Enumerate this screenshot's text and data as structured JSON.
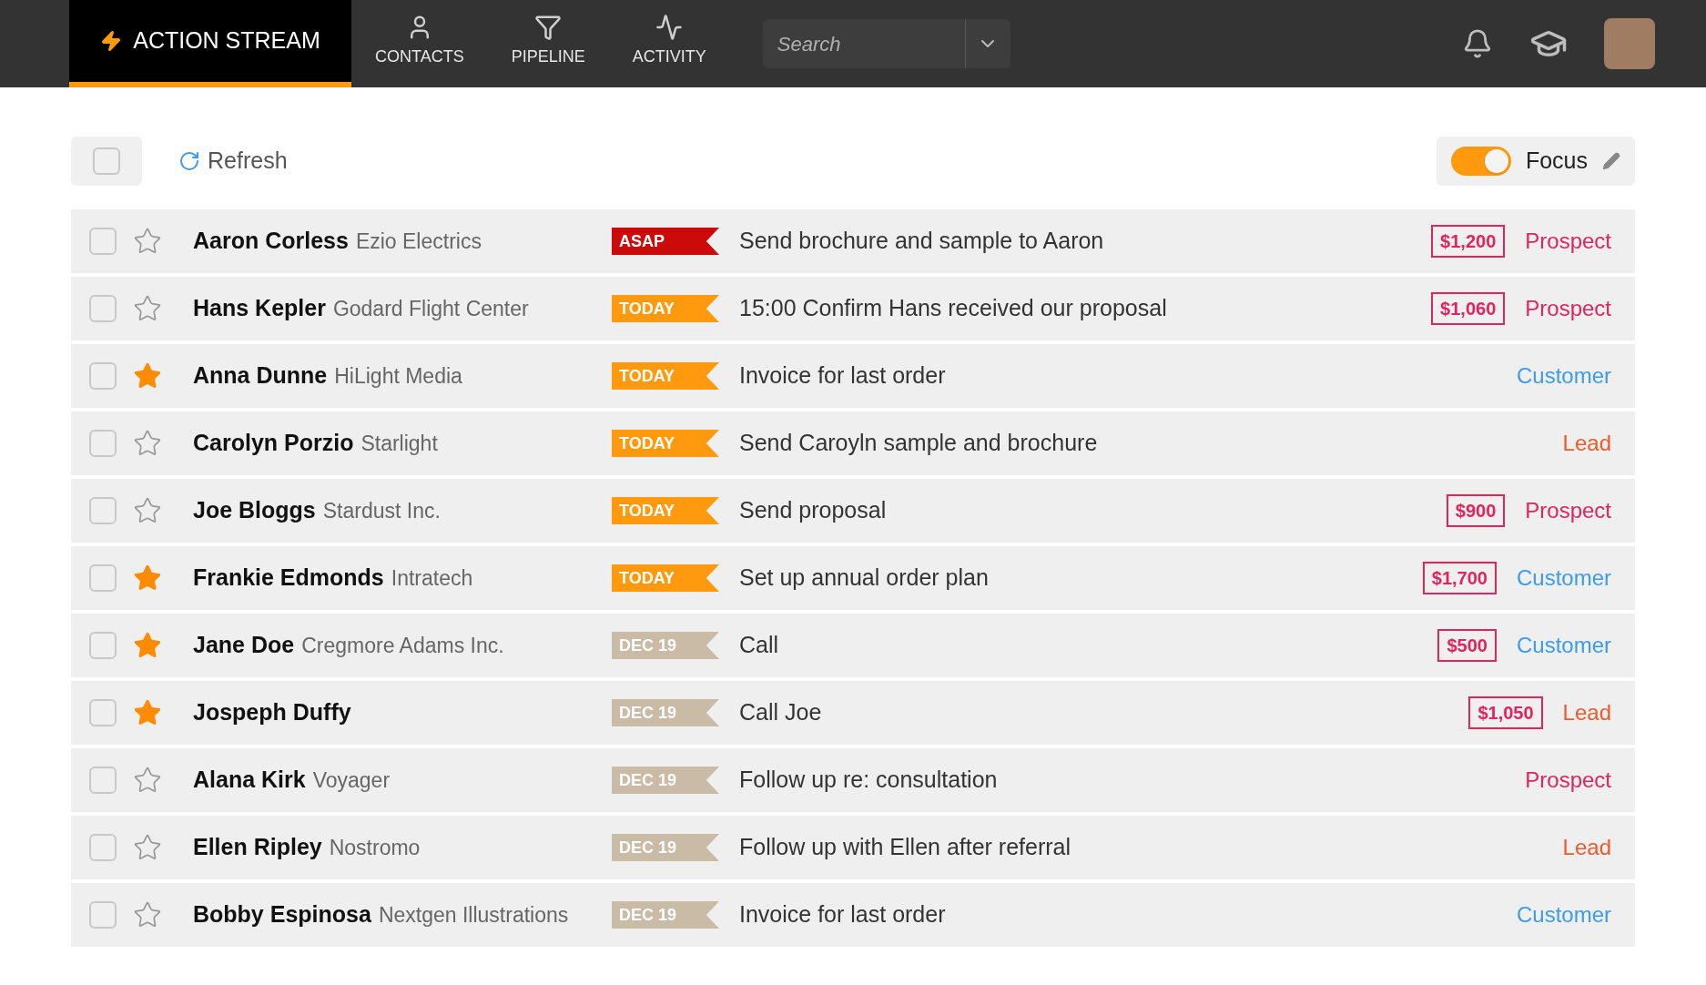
{
  "nav": {
    "tabs": [
      {
        "label": "ACTION STREAM",
        "selected": true
      },
      {
        "label": "CONTACTS",
        "selected": false
      },
      {
        "label": "PIPELINE",
        "selected": false
      },
      {
        "label": "ACTIVITY",
        "selected": false
      }
    ],
    "search": {
      "placeholder": "Search"
    }
  },
  "toolbar": {
    "select_all": {
      "checked": false
    },
    "refresh": "Refresh",
    "focus": {
      "label": "Focus",
      "on": true
    }
  },
  "rows": [
    {
      "checked": false,
      "starred": false,
      "name": "Aaron Corless",
      "company": "Ezio Electrics",
      "tag": {
        "kind": "asap",
        "label": "ASAP"
      },
      "task": "Send brochure and sample to Aaron",
      "amount": "$1,200",
      "status": {
        "kind": "prospect",
        "label": "Prospect"
      }
    },
    {
      "checked": false,
      "starred": false,
      "name": "Hans Kepler",
      "company": "Godard Flight Center",
      "tag": {
        "kind": "today",
        "label": "TODAY"
      },
      "task": "15:00 Confirm Hans received our proposal",
      "amount": "$1,060",
      "status": {
        "kind": "prospect",
        "label": "Prospect"
      }
    },
    {
      "checked": false,
      "starred": true,
      "name": "Anna Dunne",
      "company": "HiLight Media",
      "tag": {
        "kind": "today",
        "label": "TODAY"
      },
      "task": "Invoice for last order",
      "status": {
        "kind": "customer",
        "label": "Customer"
      }
    },
    {
      "checked": false,
      "starred": false,
      "name": "Carolyn Porzio",
      "company": "Starlight",
      "tag": {
        "kind": "today",
        "label": "TODAY"
      },
      "task": "Send Caroyln sample and brochure",
      "status": {
        "kind": "lead",
        "label": "Lead"
      }
    },
    {
      "checked": false,
      "starred": false,
      "name": "Joe Bloggs",
      "company": "Stardust Inc.",
      "tag": {
        "kind": "today",
        "label": "TODAY"
      },
      "task": "Send proposal",
      "amount": "$900",
      "status": {
        "kind": "prospect",
        "label": "Prospect"
      }
    },
    {
      "checked": false,
      "starred": true,
      "name": "Frankie Edmonds",
      "company": "Intratech",
      "tag": {
        "kind": "today",
        "label": "TODAY"
      },
      "task": "Set up annual order plan",
      "amount": "$1,700",
      "status": {
        "kind": "customer",
        "label": "Customer"
      }
    },
    {
      "checked": false,
      "starred": true,
      "name": "Jane Doe",
      "company": "Cregmore Adams Inc.",
      "tag": {
        "kind": "date",
        "label": "DEC 19"
      },
      "task": "Call",
      "amount": "$500",
      "status": {
        "kind": "customer",
        "label": "Customer"
      }
    },
    {
      "checked": false,
      "starred": true,
      "name": "Jospeph Duffy",
      "tag": {
        "kind": "date",
        "label": "DEC 19"
      },
      "task": "Call Joe",
      "amount": "$1,050",
      "status": {
        "kind": "lead",
        "label": "Lead"
      }
    },
    {
      "checked": false,
      "starred": false,
      "name": "Alana Kirk",
      "company": "Voyager",
      "tag": {
        "kind": "date",
        "label": "DEC 19"
      },
      "task": "Follow up re: consultation",
      "status": {
        "kind": "prospect",
        "label": "Prospect"
      }
    },
    {
      "checked": false,
      "starred": false,
      "name": "Ellen Ripley",
      "company": "Nostromo",
      "tag": {
        "kind": "date",
        "label": "DEC 19"
      },
      "task": "Follow up with Ellen after referral",
      "status": {
        "kind": "lead",
        "label": "Lead"
      }
    },
    {
      "checked": false,
      "starred": false,
      "name": "Bobby Espinosa",
      "company": "Nextgen Illustrations",
      "tag": {
        "kind": "date",
        "label": "DEC 19"
      },
      "task": "Invoice for last order",
      "status": {
        "kind": "customer",
        "label": "Customer"
      }
    }
  ]
}
